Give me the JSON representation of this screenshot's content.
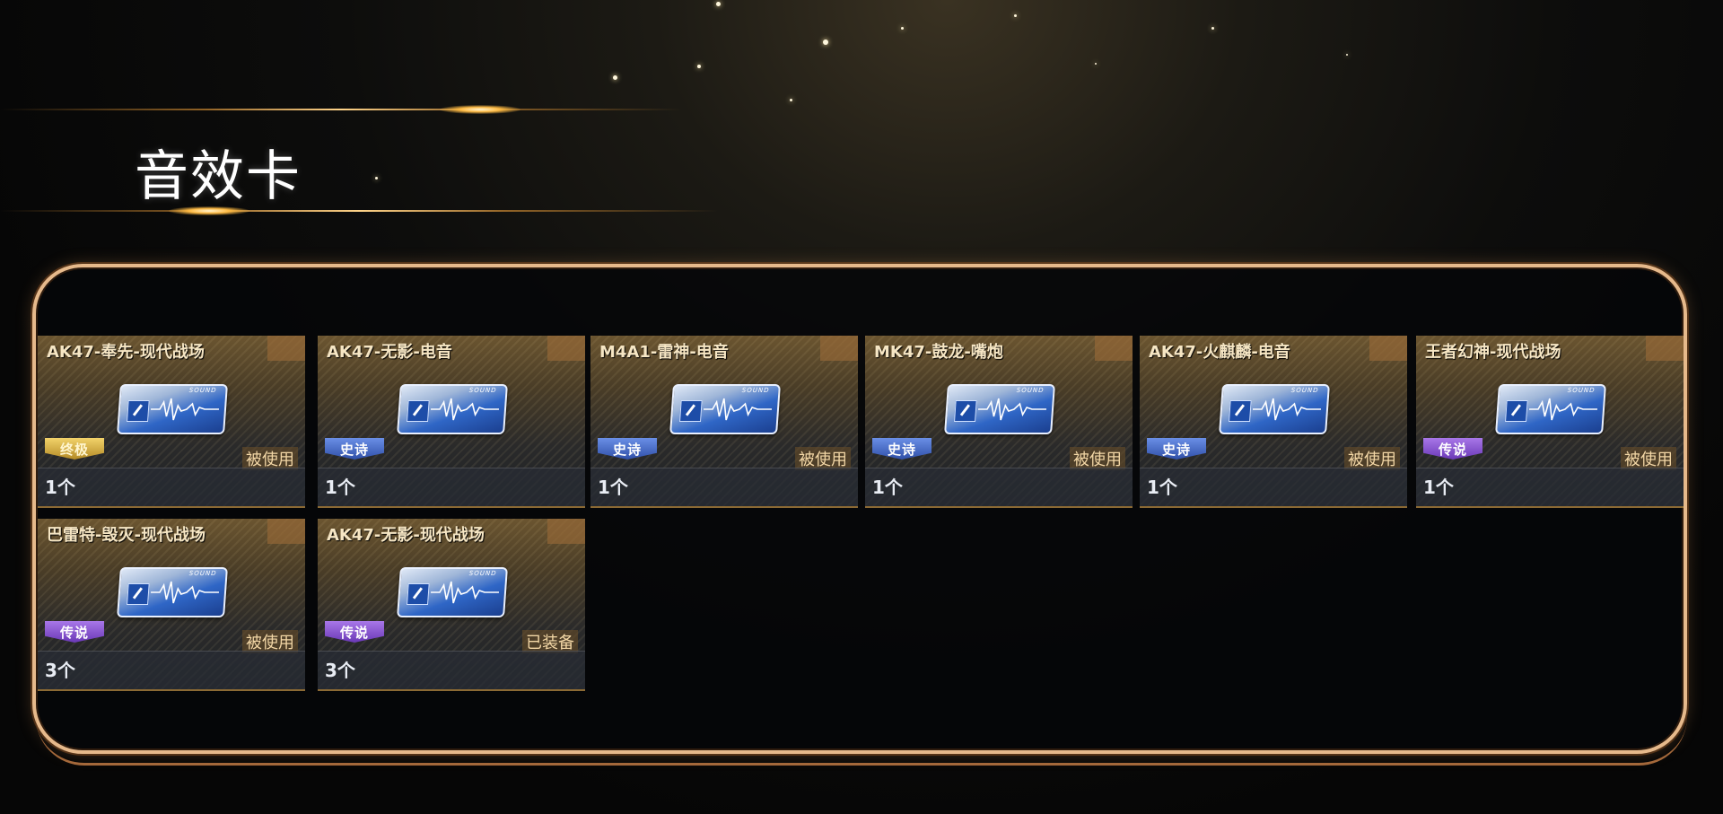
{
  "page": {
    "title": "音效卡"
  },
  "cards": [
    {
      "name": "AK47-奉先-现代战场",
      "rarity": "终极",
      "rarity_class": "final",
      "status": "被使用",
      "count": "1个",
      "icon": "sound-card-icon"
    },
    {
      "name": "AK47-无影-电音",
      "rarity": "史诗",
      "rarity_class": "epic",
      "status": "",
      "count": "1个",
      "icon": "sound-card-icon"
    },
    {
      "name": "M4A1-雷神-电音",
      "rarity": "史诗",
      "rarity_class": "epic",
      "status": "被使用",
      "count": "1个",
      "icon": "sound-card-icon"
    },
    {
      "name": "MK47-鼓龙-嘴炮",
      "rarity": "史诗",
      "rarity_class": "epic",
      "status": "被使用",
      "count": "1个",
      "icon": "sound-card-icon"
    },
    {
      "name": "AK47-火麒麟-电音",
      "rarity": "史诗",
      "rarity_class": "epic",
      "status": "被使用",
      "count": "1个",
      "icon": "sound-card-icon"
    },
    {
      "name": "王者幻神-现代战场",
      "rarity": "传说",
      "rarity_class": "legend",
      "status": "被使用",
      "count": "1个",
      "icon": "sound-card-icon"
    },
    {
      "name": "巴雷特-毁灭-现代战场",
      "rarity": "传说",
      "rarity_class": "legend",
      "status": "被使用",
      "count": "3个",
      "icon": "sound-card-icon"
    },
    {
      "name": "AK47-无影-现代战场",
      "rarity": "传说",
      "rarity_class": "legend",
      "status": "已装备",
      "count": "3个",
      "icon": "sound-card-icon"
    }
  ],
  "sound_label": "SOUND",
  "colors": {
    "panel_border": "#e6b98b",
    "legend": "#8a56d0",
    "epic": "#3f63c2",
    "final": "#d8b040",
    "status_text": "#f3d7a6"
  }
}
